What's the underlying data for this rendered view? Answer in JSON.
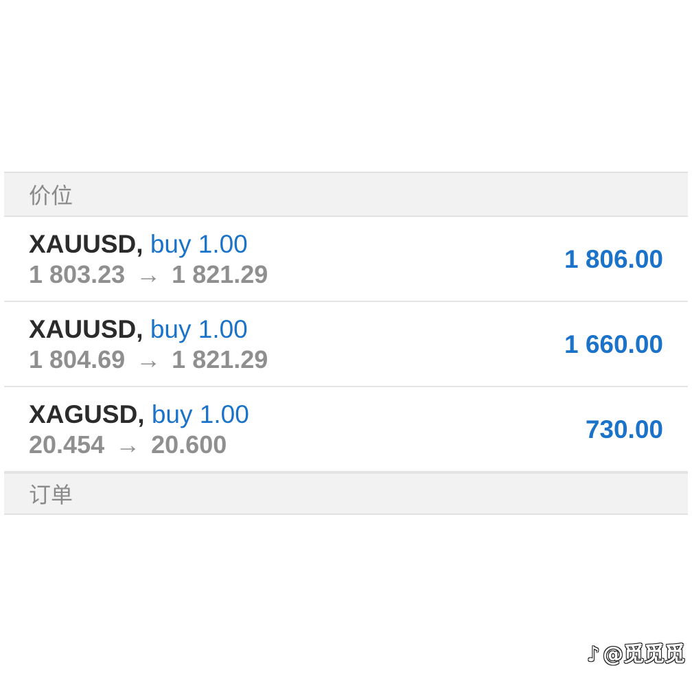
{
  "positions_header": "价位",
  "orders_header": "订单",
  "positions": [
    {
      "symbol": "XAUUSD,",
      "side": "buy 1.00",
      "open_price": "1 803.23",
      "current_price": "1 821.29",
      "profit": "1 806.00"
    },
    {
      "symbol": "XAUUSD,",
      "side": "buy 1.00",
      "open_price": "1 804.69",
      "current_price": "1 821.29",
      "profit": "1 660.00"
    },
    {
      "symbol": "XAGUSD,",
      "side": "buy 1.00",
      "open_price": "20.454",
      "current_price": "20.600",
      "profit": "730.00"
    }
  ],
  "arrow": "→",
  "watermark": {
    "icon": "douyin-icon",
    "text": "@觅觅觅"
  },
  "colors": {
    "profit": "#1a73c8",
    "side": "#1a73c8",
    "symbol": "#2b2b2b",
    "price": "#8f8f8f",
    "header_bg": "#f2f2f2",
    "header_text": "#8a8a8a"
  }
}
